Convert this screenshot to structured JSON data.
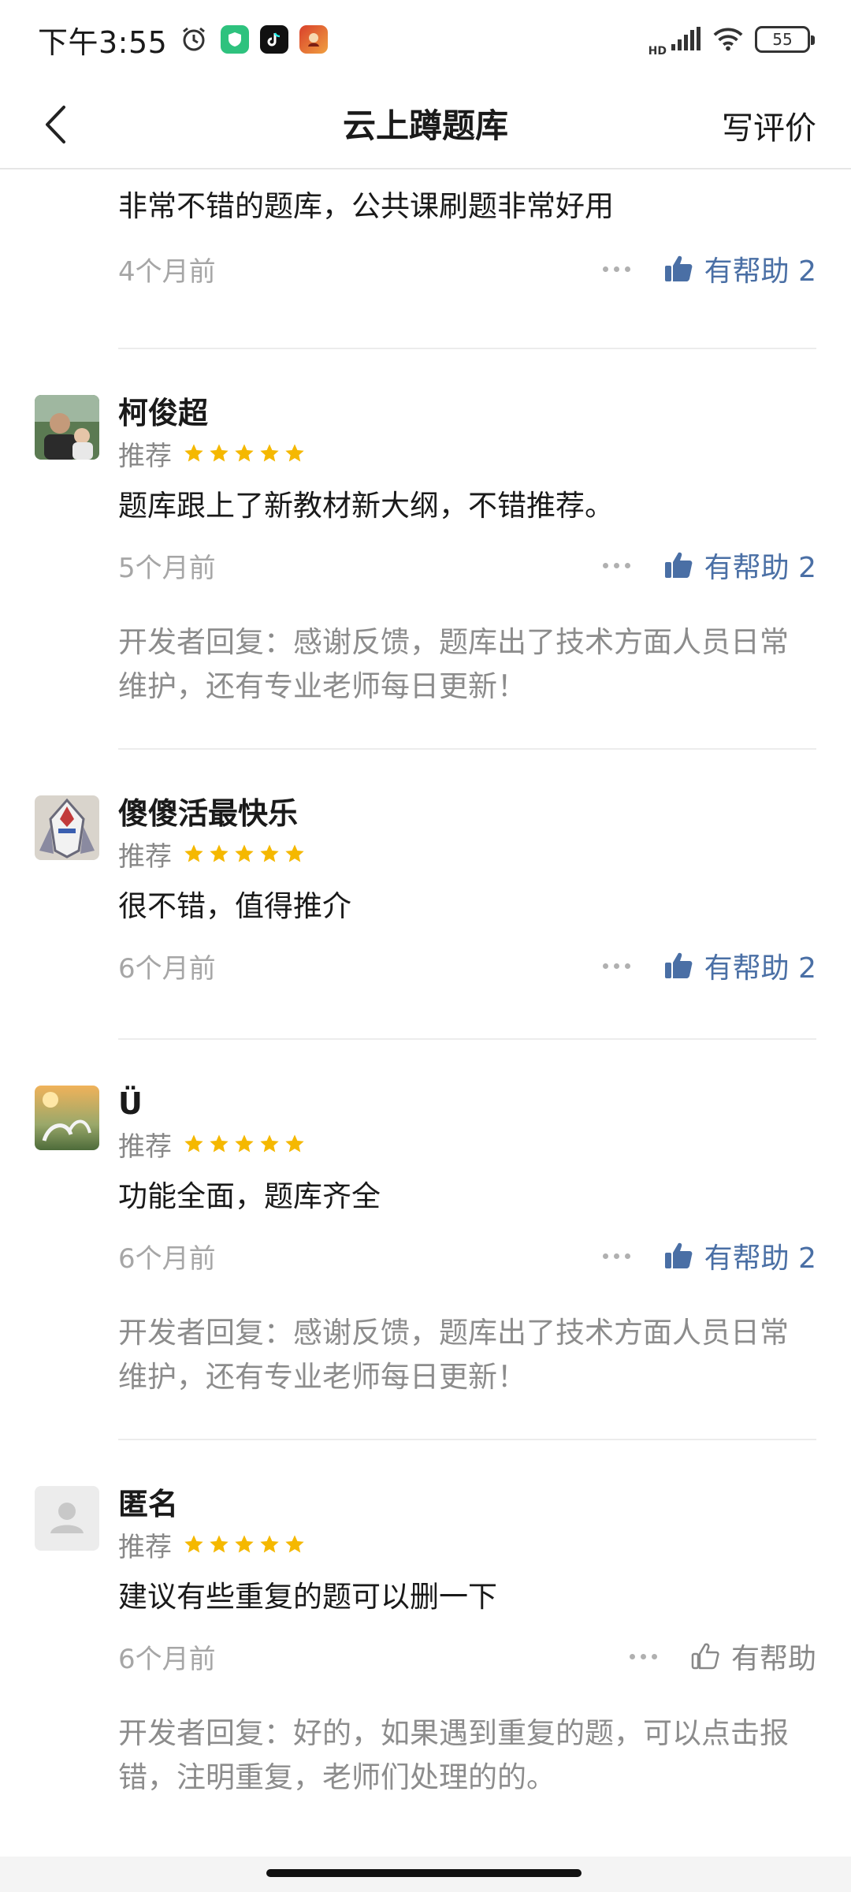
{
  "status_bar": {
    "time": "下午3:55",
    "battery": "55",
    "network_label": "HD"
  },
  "header": {
    "title": "云上蹲题库",
    "write_review": "写评价"
  },
  "reviews": [
    {
      "name": "",
      "rating_label": "",
      "text": "非常不错的题库，公共课刷题非常好用",
      "time": "4个月前",
      "helpful_label": "有帮助 2",
      "developer_reply": ""
    },
    {
      "name": "柯俊超",
      "rating_label": "推荐",
      "rating": 5,
      "text": "题库跟上了新教材新大纲，不错推荐。",
      "time": "5个月前",
      "helpful_label": "有帮助 2",
      "developer_reply": "开发者回复：感谢反馈，题库出了技术方面人员日常维护，还有专业老师每日更新！"
    },
    {
      "name": "傻傻活最快乐",
      "rating_label": "推荐",
      "rating": 5,
      "text": "很不错，值得推介",
      "time": "6个月前",
      "helpful_label": "有帮助 2",
      "developer_reply": ""
    },
    {
      "name": "Ü",
      "rating_label": "推荐",
      "rating": 5,
      "text": "功能全面，题库齐全",
      "time": "6个月前",
      "helpful_label": "有帮助 2",
      "developer_reply": "开发者回复：感谢反馈，题库出了技术方面人员日常维护，还有专业老师每日更新！"
    },
    {
      "name": "匿名",
      "rating_label": "推荐",
      "rating": 5,
      "text": "建议有些重复的题可以删一下",
      "time": "6个月前",
      "helpful_label": "有帮助",
      "developer_reply": "开发者回复：好的，如果遇到重复的题，可以点击报错，注明重复，老师们处理的的。"
    }
  ],
  "colors": {
    "accent": "#4a6fa5",
    "star": "#f5b800",
    "muted": "#8c8c8c"
  }
}
